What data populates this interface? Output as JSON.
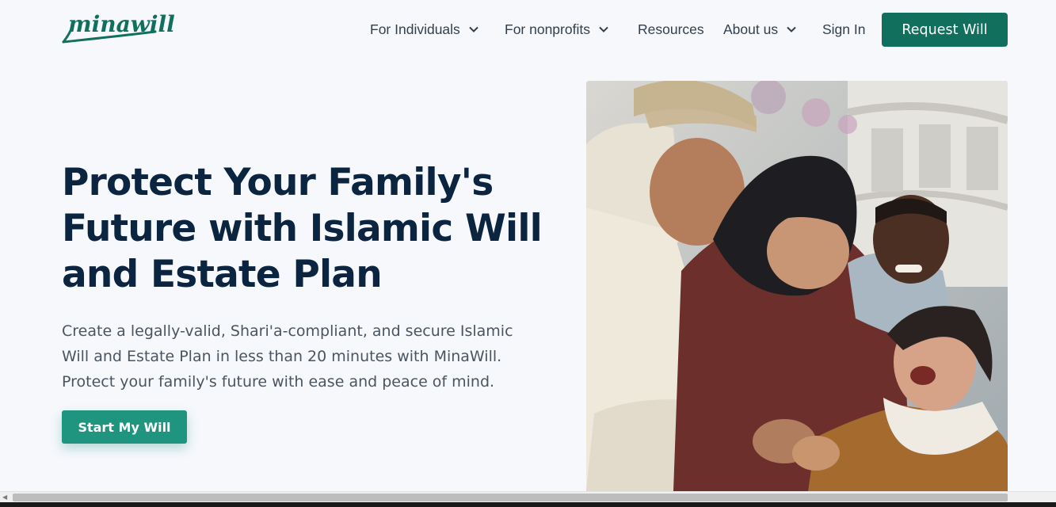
{
  "brand": {
    "logo_text": "minawill"
  },
  "nav": {
    "items": [
      {
        "label": "For Individuals",
        "has_dropdown": true
      },
      {
        "label": "For nonprofits",
        "has_dropdown": true
      },
      {
        "label": "Resources",
        "has_dropdown": false
      },
      {
        "label": "About us",
        "has_dropdown": true
      },
      {
        "label": "Sign In",
        "has_dropdown": false
      }
    ],
    "cta_label": "Request Will"
  },
  "hero": {
    "title": "Protect Your Family's Future with Islamic Will and Estate Plan",
    "subtitle": "Create a legally-valid, Shari'a-compliant, and secure Islamic Will and Estate Plan in less than 20 minutes with MinaWill. Protect your family's future with ease and peace of mind.",
    "cta_label": "Start My Will"
  },
  "colors": {
    "brand_green": "#11705d",
    "cta_green": "#1f957f",
    "heading_navy": "#0b2540",
    "page_bg": "#f6f8fc"
  },
  "icons": {
    "dropdown": "chevron-down-icon",
    "scroll_left": "chevron-left-icon"
  }
}
